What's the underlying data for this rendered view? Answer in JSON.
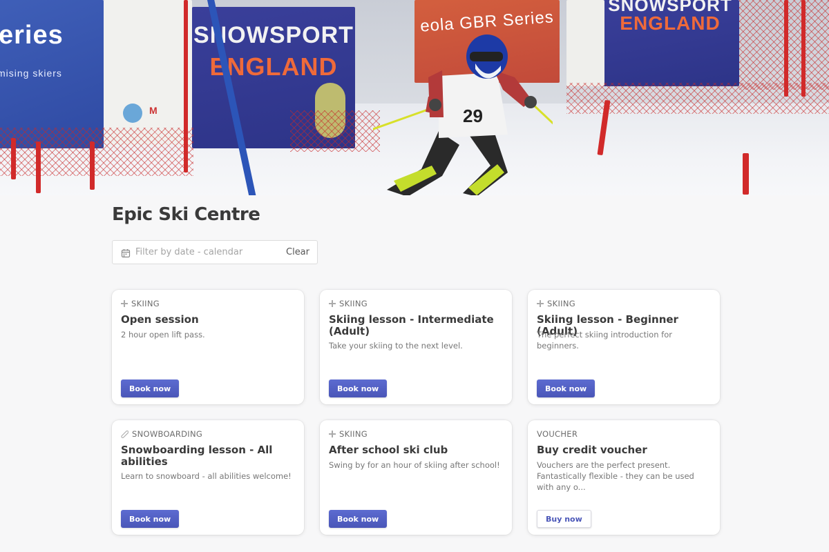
{
  "hero": {
    "banner_left_1": "eries",
    "banner_left_2": "mising skiers",
    "banner_mid_1": "SNOWSPORT",
    "banner_mid_2": "ENGLAND",
    "banner_right_top": "eola GBR Series",
    "banner_far_right_1": "SNOWSPORT",
    "banner_far_right_2": "ENGLAND",
    "bib_number": "29"
  },
  "page": {
    "title": "Epic Ski Centre"
  },
  "filter": {
    "placeholder": "Filter by date - calendar",
    "clear_label": "Clear"
  },
  "cards": [
    {
      "category": "SKIING",
      "category_icon": "ski-cross-icon",
      "title": "Open session",
      "description": "2 hour open lift pass.",
      "button": "Book now"
    },
    {
      "category": "SKIING",
      "category_icon": "ski-cross-icon",
      "title": "Skiing lesson - Intermediate (Adult)",
      "description": "Take your skiing to the next level.",
      "button": "Book now"
    },
    {
      "category": "SKIING",
      "category_icon": "ski-cross-icon",
      "title": "Skiing lesson - Beginner (Adult)",
      "description": "The perfect skiing introduction for beginners.",
      "button": "Book now"
    },
    {
      "category": "SNOWBOARDING",
      "category_icon": "snowboard-icon",
      "title": "Snowboarding lesson - All abilities",
      "description": "Learn to snowboard - all abilities welcome!",
      "button": "Book now"
    },
    {
      "category": "SKIING",
      "category_icon": "ski-cross-icon",
      "title": "After school ski club",
      "description": "Swing by for an hour of skiing after school!",
      "button": "Book now"
    },
    {
      "category": "VOUCHER",
      "category_icon": "",
      "title": "Buy credit voucher",
      "description": "Vouchers are the perfect present. Fantastically flexible - they can be used with any o...",
      "button": "Buy now"
    }
  ],
  "colors": {
    "accent": "#4a56b8",
    "background": "#f7f7f8",
    "card": "#ffffff"
  }
}
